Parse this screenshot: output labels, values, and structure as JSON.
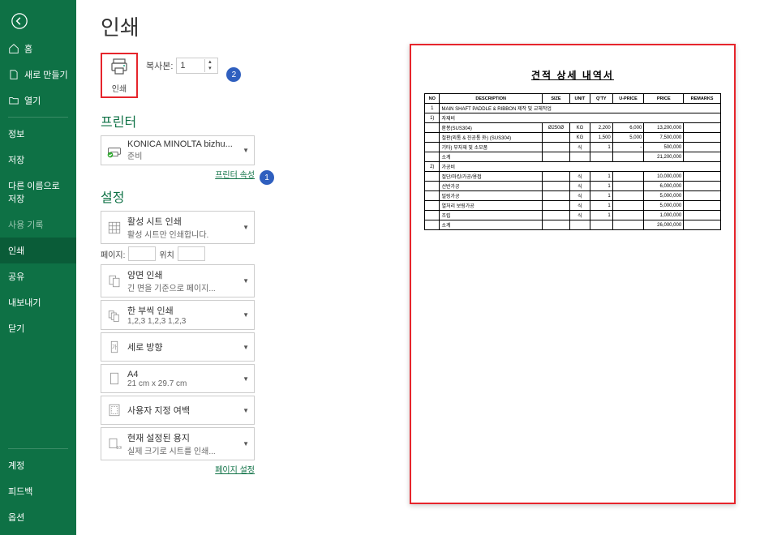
{
  "sidebar": {
    "home": "홈",
    "new": "새로 만들기",
    "open": "열기",
    "info": "정보",
    "save": "저장",
    "saveas": "다른 이름으로 저장",
    "history": "사용 기록",
    "print": "인쇄",
    "share": "공유",
    "export": "내보내기",
    "close": "닫기",
    "account": "계정",
    "feedback": "피드백",
    "options": "옵션"
  },
  "page": {
    "title": "인쇄",
    "print_btn": "인쇄",
    "copies_label": "복사본:",
    "copies_value": "1",
    "printer_heading": "프린터",
    "printer_name": "KONICA MINOLTA bizhu...",
    "printer_status": "준비",
    "printer_props": "프린터 속성",
    "settings_heading": "설정",
    "pages_label": "페이지:",
    "position_label": "위치",
    "page_setup": "페이지 설정"
  },
  "settings": {
    "scope": {
      "title": "활성 시트 인쇄",
      "sub": "활성 시트만 인쇄합니다."
    },
    "sides": {
      "title": "양면 인쇄",
      "sub": "긴 면을 기준으로 페이지..."
    },
    "collate": {
      "title": "한 부씩 인쇄",
      "sub": "1,2,3     1,2,3    1,2,3"
    },
    "orient": {
      "title": "세로 방향",
      "sub": ""
    },
    "paper": {
      "title": "A4",
      "sub": "21 cm x 29.7 cm"
    },
    "margins": {
      "title": "사용자 지정 여백",
      "sub": ""
    },
    "scale": {
      "title": "현재 설정된 용지",
      "sub": "실제 크기로 시트를 인쇄..."
    }
  },
  "annotations": {
    "one": "1",
    "two": "2"
  },
  "doc": {
    "title": "견적 상세 내역서",
    "headers": [
      "NO",
      "DESCRIPTION",
      "SIZE",
      "UNIT",
      "Q'TY",
      "U-PRICE",
      "PRICE",
      "REMARKS"
    ],
    "section1_no": "1",
    "section1_title": "MAIN SHAFT PADDLE & RIBBON 제작 및 교체작업",
    "sub1_no": "1)",
    "sub1_title": "자재비",
    "rows1": [
      [
        "",
        "환봉(SUS304)",
        "Ø250Ø",
        "KG",
        "2,200",
        "6,000",
        "13,200,000",
        ""
      ],
      [
        "",
        "철판(외통 & 진공통 外) (SUS304)",
        "",
        "KG",
        "1,500",
        "5,000",
        "7,500,000",
        ""
      ],
      [
        "",
        "기타) 부자재 및 소모품",
        "",
        "식",
        "1",
        "-",
        "500,000",
        ""
      ],
      [
        "",
        "소계",
        "",
        "",
        "",
        "",
        "21,200,000",
        ""
      ]
    ],
    "sub2_no": "2)",
    "sub2_title": "가공비",
    "rows2": [
      [
        "",
        "절단/마킹/가공/용접",
        "",
        "식",
        "1",
        "",
        "10,000,000",
        ""
      ],
      [
        "",
        "선반가공",
        "",
        "식",
        "1",
        "",
        "6,000,000",
        ""
      ],
      [
        "",
        "밀링가공",
        "",
        "식",
        "1",
        "",
        "5,000,000",
        ""
      ],
      [
        "",
        "열처리 보링가공",
        "",
        "식",
        "1",
        "",
        "5,000,000",
        ""
      ],
      [
        "",
        "조립",
        "",
        "식",
        "1",
        "",
        "1,000,000",
        ""
      ],
      [
        "",
        "소계",
        "",
        "",
        "",
        "",
        "26,000,000",
        ""
      ]
    ]
  }
}
